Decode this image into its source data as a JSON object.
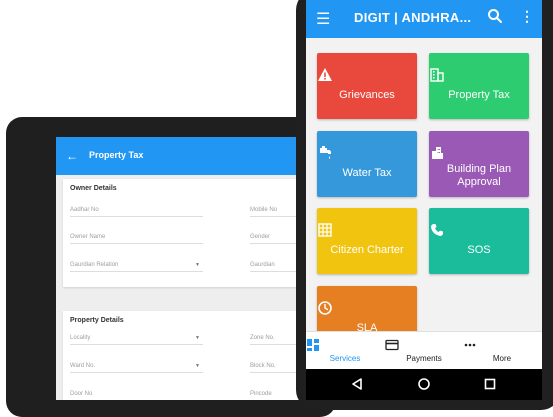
{
  "tablet": {
    "title": "Property Tax",
    "back_icon": "arrow-left-icon",
    "owner_section": {
      "heading": "Owner Details",
      "fields_left": [
        "Aadhar No",
        "Owner Name",
        "Gaurdian Relation"
      ],
      "fields_right": [
        "Mobile No",
        "Gender",
        "Gaurdian"
      ]
    },
    "property_section": {
      "heading": "Property Details",
      "fields_left": [
        "Locality",
        "Ward No.",
        "Door No"
      ],
      "fields_right": [
        "Zone No.",
        "Block No.",
        "Pincode"
      ]
    }
  },
  "phone": {
    "title": "DIGIT | ANDHRA...",
    "tiles": [
      {
        "label": "Grievances",
        "icon": "warning-icon",
        "color": "#e9493c"
      },
      {
        "label": "Property Tax",
        "icon": "building-icon",
        "color": "#2ecc71"
      },
      {
        "label": "Water Tax",
        "icon": "water-tap-icon",
        "color": "#3498db"
      },
      {
        "label": "Building Plan Approval",
        "icon": "city-icon",
        "color": "#9b59b6"
      },
      {
        "label": "Citizen Charter",
        "icon": "grid-icon",
        "color": "#f1c40f"
      },
      {
        "label": "SOS",
        "icon": "phone-icon",
        "color": "#1abc9c"
      },
      {
        "label": "SLA",
        "icon": "clock-icon",
        "color": "#e67e22"
      }
    ],
    "bottom_nav": [
      {
        "label": "Services",
        "icon": "dashboard-icon",
        "active": true
      },
      {
        "label": "Payments",
        "icon": "card-icon",
        "active": false
      },
      {
        "label": "More",
        "icon": "more-horiz-icon",
        "active": false
      }
    ],
    "accent_color": "#2196f3"
  }
}
